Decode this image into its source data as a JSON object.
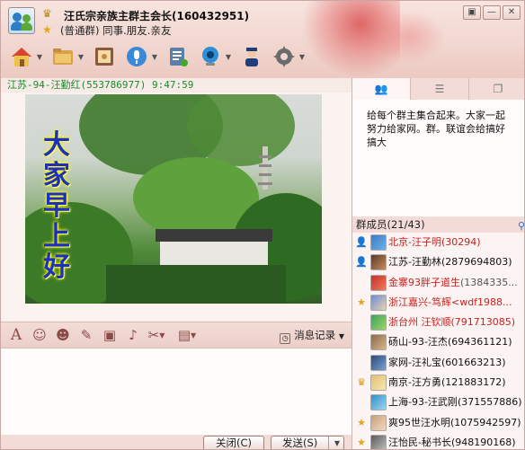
{
  "window": {
    "group_name": "汪氏宗亲族主群主会长(160432951)",
    "group_subtitle": "(普通群) 同事.朋友.亲友",
    "buttons": [
      "▣",
      "—",
      "✕"
    ]
  },
  "toolbar": {
    "icons": [
      "home-icon",
      "folder-icon",
      "album-icon",
      "voice-icon",
      "note-icon",
      "webcam-icon",
      "admin-icon",
      "settings-icon"
    ]
  },
  "chat": {
    "message_header": "江苏-94-汪勤红(553786977) 9:47:59",
    "image_text": "大家早上好"
  },
  "format_bar": {
    "icons": [
      "font-icon",
      "emoji-icon",
      "face-icon",
      "edit-icon",
      "image-icon",
      "music-icon",
      "scissors-icon",
      "screen-icon"
    ],
    "history_label": "消息记录"
  },
  "buttons": {
    "close_label": "关闭(C)",
    "send_label": "发送(S)"
  },
  "right_panel": {
    "tabs": [
      "members-tab",
      "list-tab",
      "window-tab"
    ],
    "announcement": "给每个群主集合起来。大家一起努力给家网。群。联谊会给搞好搞大",
    "members_header": "群成员(21/43)",
    "members": [
      {
        "name": "北京-汪子明",
        "id": "(30294)",
        "color": "red",
        "badge": "user"
      },
      {
        "name": "江苏-汪勤林",
        "id": "(2879694803)",
        "color": "black",
        "badge": "user"
      },
      {
        "name": "金寨93胖子道生",
        "id": "(1384335...",
        "color": "red",
        "badge": ""
      },
      {
        "name": "浙江嘉兴-笃辉",
        "id": "<wdf1988...",
        "color": "red",
        "badge": "star"
      },
      {
        "name": "浙台州 汪钦顺",
        "id": "(791713085)",
        "color": "red",
        "badge": ""
      },
      {
        "name": "砀山-93-汪杰",
        "id": "(694361121)",
        "color": "black",
        "badge": ""
      },
      {
        "name": "家网-汪礼宝",
        "id": "(601663213)",
        "color": "black",
        "badge": ""
      },
      {
        "name": "南京-汪方勇",
        "id": "(121883172)",
        "color": "black",
        "badge": "crown"
      },
      {
        "name": "上海-93-汪武刚",
        "id": "(371557886)",
        "color": "black",
        "badge": ""
      },
      {
        "name": "爽95世汪水明",
        "id": "(1075942597)",
        "color": "black",
        "badge": "star"
      },
      {
        "name": "汪怡民-秘书长",
        "id": "(948190168)",
        "color": "black",
        "badge": "star"
      }
    ]
  }
}
